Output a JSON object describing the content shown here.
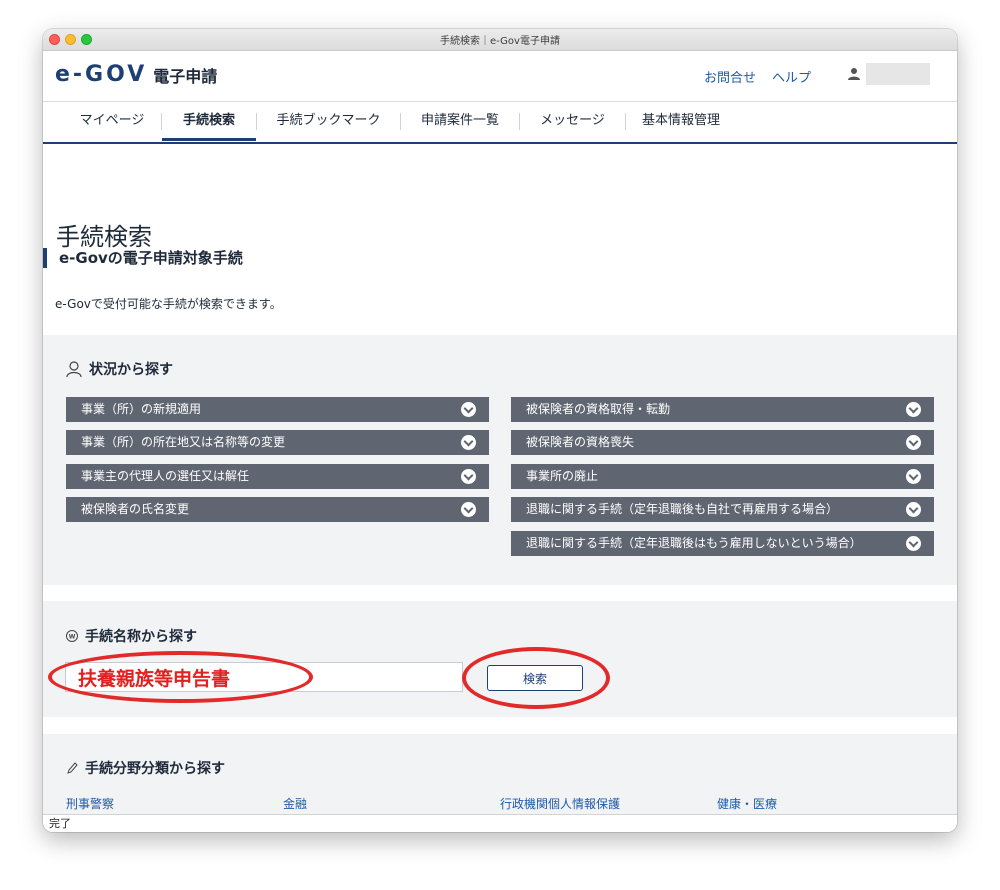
{
  "window": {
    "title": "手続検索｜e-Gov電子申請"
  },
  "header": {
    "logo_mark": "e-GOV",
    "logo_text": "電子申請",
    "links": [
      "お問合せ",
      "ヘルプ"
    ]
  },
  "nav": {
    "items": [
      "マイページ",
      "手続検索",
      "手続ブックマーク",
      "申請案件一覧",
      "メッセージ",
      "基本情報管理"
    ],
    "active": "手続検索"
  },
  "main": {
    "title": "手続検索",
    "section_heading": "e-Govの電子申請対象手続",
    "description": "e-Govで受付可能な手続が検索できます。"
  },
  "situation": {
    "title": "状況から探す",
    "left": [
      "事業（所）の新規適用",
      "事業（所）の所在地又は名称等の変更",
      "事業主の代理人の選任又は解任",
      "被保険者の氏名変更"
    ],
    "right": [
      "被保険者の資格取得・転勤",
      "被保険者の資格喪失",
      "事業所の廃止",
      "退職に関する手続（定年退職後も自社で再雇用する場合）",
      "退職に関する手続（定年退職後はもう雇用しないという場合）"
    ]
  },
  "name_search": {
    "title": "手続名称から探す",
    "input_value": "扶養親族等申告書",
    "button_label": "検索",
    "annotation_color": "#e22a2a"
  },
  "category": {
    "title": "手続分野分類から探す",
    "links": [
      "刑事警察",
      "金融",
      "行政機関個人情報保護",
      "健康・医療"
    ]
  },
  "status_bar": {
    "text": "完了"
  },
  "colors": {
    "brand": "#1d3f74",
    "accent": "#2aa0d8",
    "accordion": "#5f6672",
    "link": "#1d5aa7"
  }
}
